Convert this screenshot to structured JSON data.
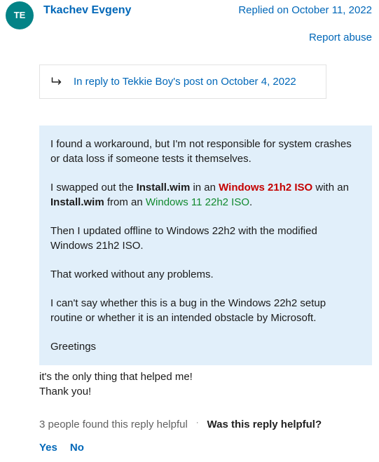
{
  "author": {
    "initials": "TE",
    "name": "Tkachev Evgeny"
  },
  "meta": {
    "replied_on": "Replied on October 11, 2022",
    "report_abuse": "Report abuse"
  },
  "reply_ref": {
    "text": "In reply to Tekkie Boy's post on October 4, 2022"
  },
  "quote": {
    "p1": "I found a workaround, but I'm not responsible for system crashes or data loss if someone tests it themselves.",
    "p2_a": "I swapped out the ",
    "p2_b": "Install.wim",
    "p2_c": " in an ",
    "p2_d": "Windows 21h2 ISO",
    "p2_e": " with an ",
    "p2_f": "Install.wim",
    "p2_g": " from an ",
    "p2_h": "Windows 11 22h2 ISO",
    "p2_i": ".",
    "p3": "Then I updated offline to Windows 22h2 with the modified Windows 21h2 ISO.",
    "p4": "That worked without any problems.",
    "p5": "I can't say whether this is a bug in the Windows 22h2 setup routine or whether it is an intended obstacle by Microsoft.",
    "p6": "Greetings"
  },
  "own": {
    "line1": "it's the only thing that helped me!",
    "line2": "Thank you!"
  },
  "footer": {
    "helpful_count": "3 people found this reply helpful",
    "helpful_question": "Was this reply helpful?",
    "yes": "Yes",
    "no": "No"
  }
}
